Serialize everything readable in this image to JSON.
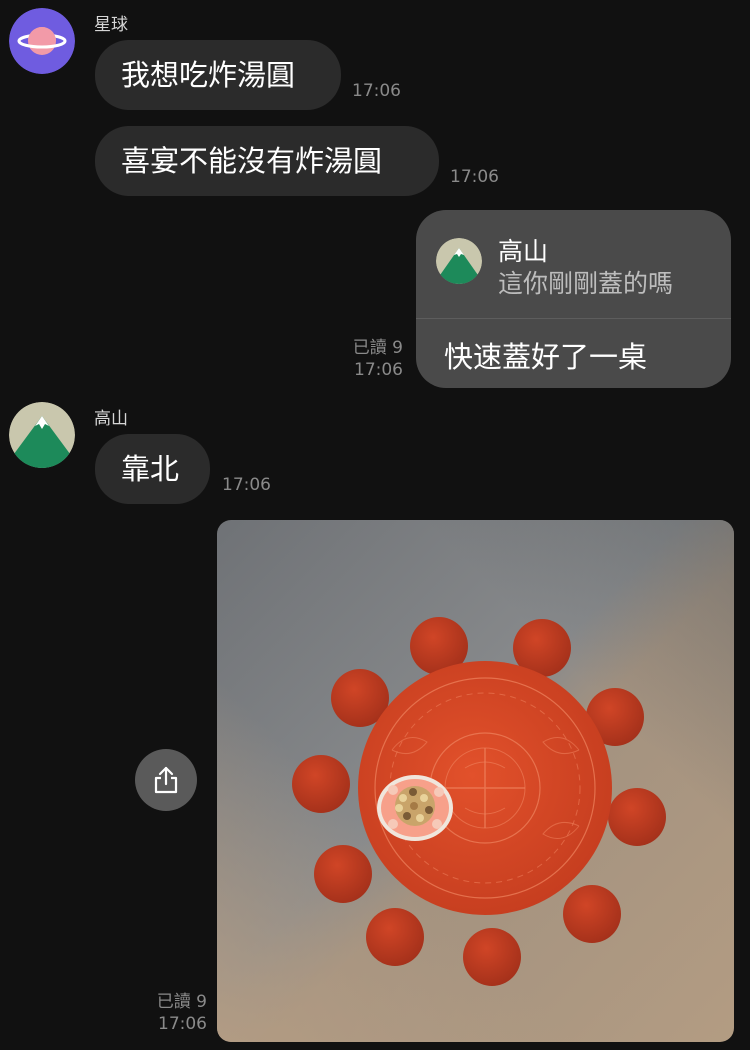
{
  "messages": [
    {
      "sender": "星球",
      "avatar_icon": "planet-icon",
      "avatar_color": "#6f5ce0",
      "text": "我想吃炸湯圓",
      "time": "17:06"
    },
    {
      "text": "喜宴不能沒有炸湯圓",
      "time": "17:06"
    },
    {
      "own": true,
      "reply_to": {
        "name": "高山",
        "avatar_icon": "mountain-icon",
        "quote": "這你剛剛蓋的嗎"
      },
      "text": "快速蓋好了一桌",
      "read": "已讀 9",
      "time": "17:06"
    },
    {
      "sender": "高山",
      "avatar_icon": "mountain-icon",
      "text": "靠北",
      "time": "17:06"
    },
    {
      "own": true,
      "type": "image",
      "image_icon": "banquet-table-photo",
      "read": "已讀 9",
      "time": "17:06",
      "share_icon": "share-icon"
    }
  ],
  "colors": {
    "background": "#111111",
    "incoming_bubble": "#2b2b2b",
    "outgoing_bubble": "#4a4a4a",
    "meta_text": "#8a8a8a"
  }
}
